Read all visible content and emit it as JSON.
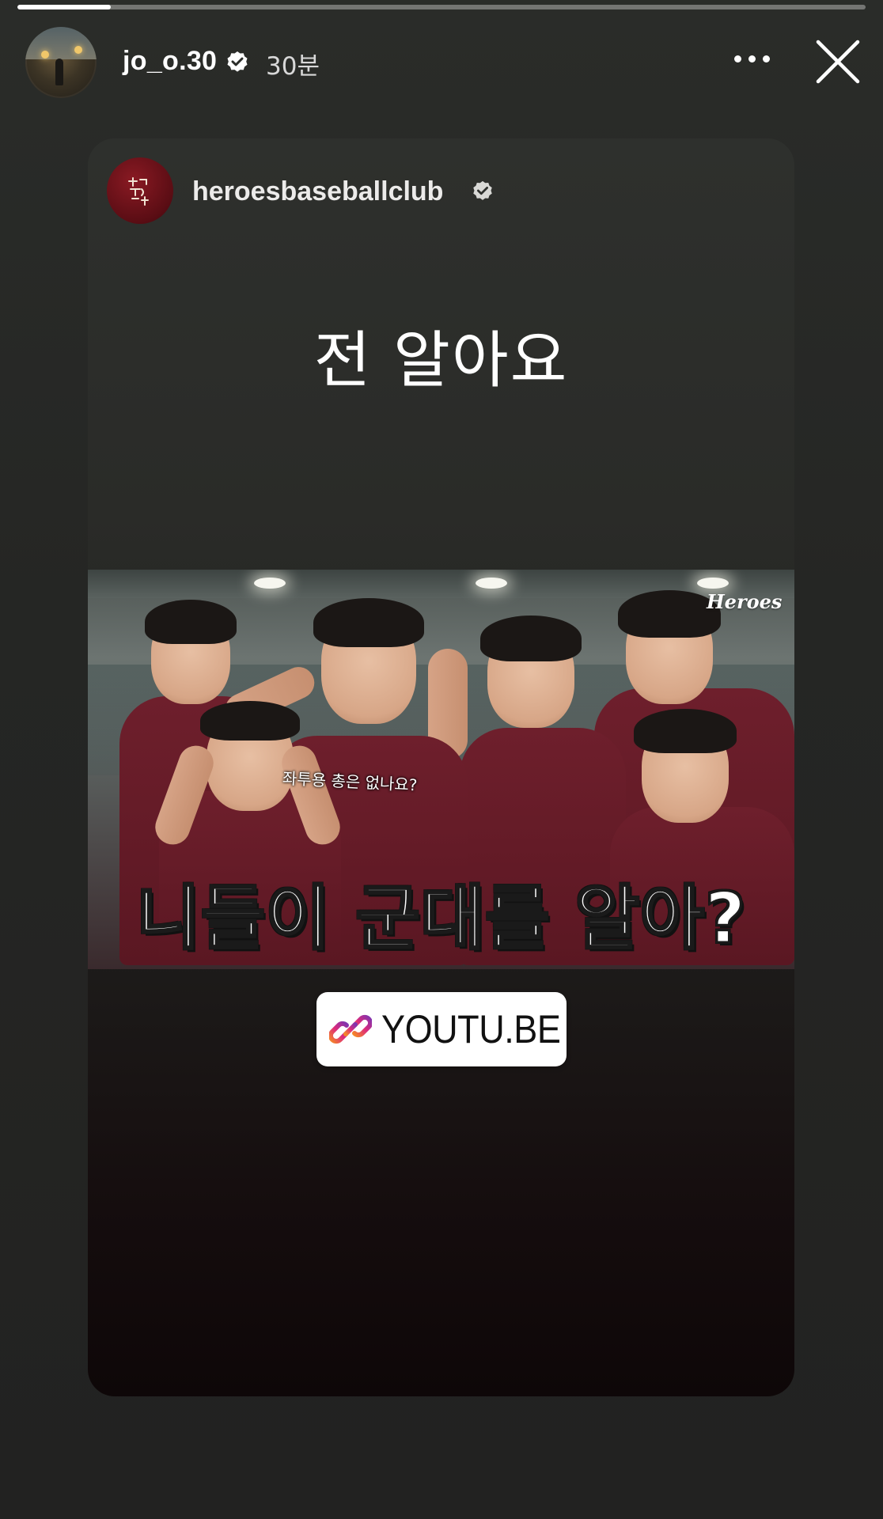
{
  "story": {
    "progress_fraction": 0.11
  },
  "header": {
    "username": "jo_o.30",
    "time_ago": "30분",
    "verified": true
  },
  "shared_post": {
    "username": "heroesbaseballclub",
    "verified": true,
    "caption": "전 알아요",
    "thumbnail": {
      "brand_mark": "Heroes",
      "subtitle_small": "좌투용 총은 없나요?",
      "headline": "니들이 군대를 알아?"
    }
  },
  "link_sticker": {
    "label": "YOUTU.BE"
  },
  "colors": {
    "background": "#252624",
    "team_maroon": "#6e1f2c",
    "link_gradient_start": "#f58529",
    "link_gradient_end": "#dd2a7b"
  },
  "icons": {
    "verified": "verified-badge-icon",
    "more": "more-options-icon",
    "close": "close-icon",
    "link": "link-icon"
  }
}
